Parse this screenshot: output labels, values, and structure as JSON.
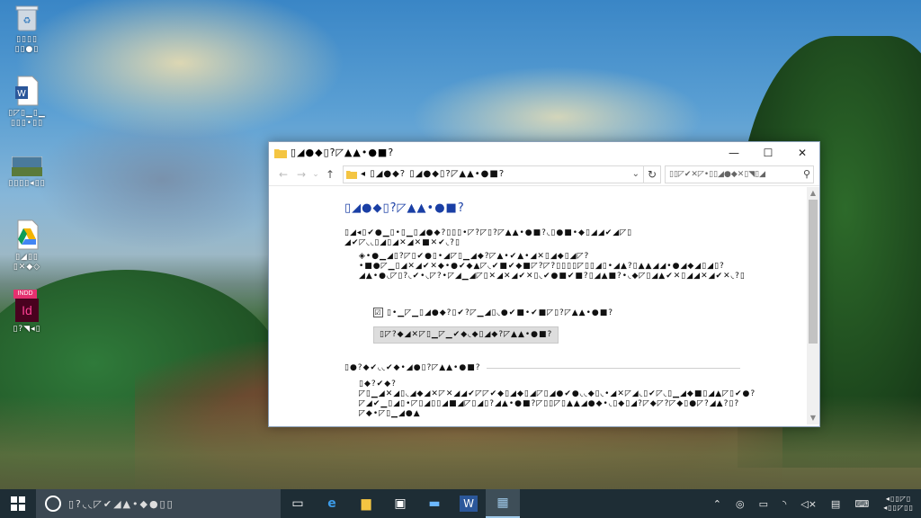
{
  "desktop": {
    "icons": [
      {
        "name": "recycle-bin",
        "label": "▯▯▯▯\n▯▯●▯"
      },
      {
        "name": "word-document",
        "label": "▯◸▯▁▯▁\n▯▯▯•▯▯"
      },
      {
        "name": "photo-file",
        "label": "▯▯▯▯◂▯▯"
      },
      {
        "name": "google-drive",
        "label": "▯◢▯▯\n▯✕◆◇"
      },
      {
        "name": "indesign",
        "label": "▯?◥◂▯",
        "badge_top": "INDD",
        "badge_main": "Id"
      }
    ]
  },
  "window": {
    "title": "▯◢●◆▯?◸▲▲•●■?",
    "controls": {
      "minimize": "—",
      "maximize": "☐",
      "close": "✕"
    },
    "nav": {
      "back": "←",
      "forward": "→",
      "recent": "⌄",
      "up": "↑"
    },
    "address": "◂ ▯◢●◆?  ▯◢●◆▯?◸▲▲•●■?",
    "refresh": "↻",
    "search_placeholder": "▯▯◸✔✕◸•▯▯◢●◆✕▯◥▯◢",
    "content": {
      "heading": "▯◢●◆▯?◸▲▲•●■?",
      "paragraph1": "▯◢◂▯✔●▁▯•▯▁▯◢●◆?▯▯▯•◸?◸▯?◸▲▲•●■?◟▯●■•◆▯◢◢✔◢◸▯ ◢✔◸◟◟▯◢▯◢✕◢✕■✕✔◟?▯",
      "paragraph2": "◈•●▁◢▯?◸▯✔●▯•◢◸▯▁◢◆?◸▲•✔▲•◢✕▯◢◆▯◢◸?•■●◸▁▯◢✕◢✔✕◆•●✔◆▲◸◟✔■✔◆■◸?◸?▯▯▯▯◸▯▯◢▯•◢▲?▯▲▲◢◢•●◢◆◢▯◢▯?◢▲•●◟◸▯?◟✔•◟◸?•◸◢▁◢◸▯✕◢✕◢✔✕▯◟✔●■✔■?▯◢▲■?•◟◆◸▯◢▲✔✕▯◢◢✕◢✔✕◟?▯",
      "checkbox_label": "▯•▁◸▁▯◢●◆?▯✔?◸▁◢▯◟●✔■•✔■◸▯?◸▲▲•●■?",
      "checkbox_state": "☑",
      "button": "▯◸?◆◢✕◸▯▁◸▁✔◆◟◆▯◢◆?◸▲▲•●■?",
      "section_title": "▯●?◆✔◟◟✔◆•◢●▯?◸▲▲•●■?",
      "paragraph3": "▯◆?✔◆?◸▯▁◢✕◢▯◟◢◆◢✕◸✕◢◢✔◸◸✔◆▯◢◆▯◢◸▯◢●✔●◟◟◆▯◟•◢✕◸◢◟▯✔◸◟▯▁◢◆■▯◢▲◸▯✔●?◸◢✔▁▯◢▯•◸▯◢▯▯◢■◢◸▯◢▯?◢▲•●■?◸▯▯◸▯▲▲◢●◆•◟▯◆▯◢?◸◆◸?◸◆▯●◸?◢▲?▯?◸◆•◸▯▁◢●▲"
    }
  },
  "taskbar": {
    "search_text": "▯?◟◟◸✔◢▲•◆●▯▯",
    "apps": [
      {
        "name": "task-view",
        "glyph": "▭"
      },
      {
        "name": "edge",
        "glyph": "e"
      },
      {
        "name": "file-explorer",
        "glyph": "▆"
      },
      {
        "name": "store",
        "glyph": "▣"
      },
      {
        "name": "computer",
        "glyph": "▬"
      },
      {
        "name": "word",
        "glyph": "W"
      },
      {
        "name": "photos",
        "glyph": "▦"
      }
    ],
    "tray": {
      "chevron": "⌃",
      "notifications": "▤",
      "keyboard": "⌨"
    },
    "clock": {
      "line1": "◂▯▯◸▯",
      "line2": "◂▯▯◸▯▯"
    }
  },
  "colors": {
    "heading": "#1a3fa5",
    "taskbar": "#1e2d35",
    "cortana": "#3b4852"
  }
}
